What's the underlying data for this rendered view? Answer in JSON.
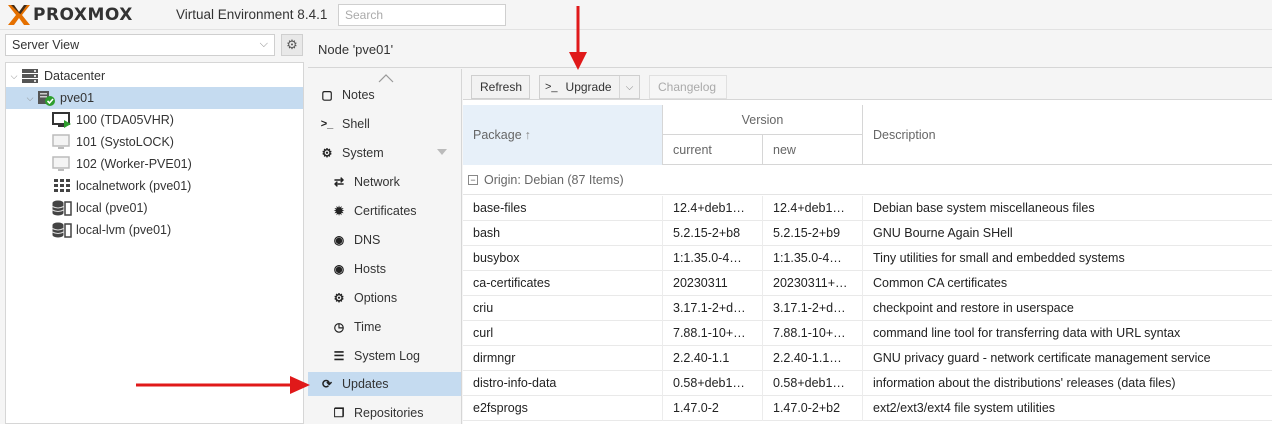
{
  "colors": {
    "accent_select": "#c5dbf0",
    "arrow": "#e0191a",
    "logo_orange": "#e57000"
  },
  "header": {
    "logo_text": "PROXMOX",
    "product": "Virtual Environment 8.4.1",
    "search_placeholder": "Search"
  },
  "left": {
    "view_select": "Server View",
    "tree": [
      {
        "label": "Datacenter",
        "icon": "datacenter-icon"
      },
      {
        "label": "pve01",
        "icon": "node-online-icon"
      },
      {
        "label": "100 (TDA05VHR)",
        "icon": "vm-running-icon"
      },
      {
        "label": "101 (SystoLOCK)",
        "icon": "vm-stopped-icon"
      },
      {
        "label": "102 (Worker-PVE01)",
        "icon": "vm-stopped-icon"
      },
      {
        "label": "localnetwork (pve01)",
        "icon": "sdn-grid-icon"
      },
      {
        "label": "local (pve01)",
        "icon": "storage-icon"
      },
      {
        "label": "local-lvm (pve01)",
        "icon": "storage-icon"
      }
    ]
  },
  "main": {
    "node_title": "Node 'pve01'",
    "menu": [
      {
        "label": "Notes",
        "icon": "notes-icon",
        "glyph": "▢"
      },
      {
        "label": "Shell",
        "icon": "shell-icon",
        "glyph": ">_"
      },
      {
        "label": "System",
        "icon": "system-cogs-icon",
        "glyph": "⚙"
      },
      {
        "label": "Network",
        "icon": "network-icon",
        "glyph": "⇄"
      },
      {
        "label": "Certificates",
        "icon": "certificate-icon",
        "glyph": "✹"
      },
      {
        "label": "DNS",
        "icon": "dns-globe-icon",
        "glyph": "◉"
      },
      {
        "label": "Hosts",
        "icon": "hosts-globe-icon",
        "glyph": "◉"
      },
      {
        "label": "Options",
        "icon": "options-gear-icon",
        "glyph": "⚙"
      },
      {
        "label": "Time",
        "icon": "clock-icon",
        "glyph": "◷"
      },
      {
        "label": "System Log",
        "icon": "log-list-icon",
        "glyph": "☰"
      },
      {
        "label": "Updates",
        "icon": "refresh-icon",
        "glyph": "⟳"
      },
      {
        "label": "Repositories",
        "icon": "repositories-icon",
        "glyph": "❐"
      }
    ],
    "toolbar": {
      "refresh": "Refresh",
      "upgrade_prefix": ">_",
      "upgrade": "Upgrade",
      "changelog": "Changelog"
    },
    "grid": {
      "headers": {
        "package": "Package",
        "version": "Version",
        "current": "current",
        "new": "new",
        "description": "Description"
      },
      "group": "Origin: Debian (87 Items)",
      "rows": [
        {
          "package": "base-files",
          "current": "12.4+deb1…",
          "new": "12.4+deb1…",
          "description": "Debian base system miscellaneous files"
        },
        {
          "package": "bash",
          "current": "5.2.15-2+b8",
          "new": "5.2.15-2+b9",
          "description": "GNU Bourne Again SHell"
        },
        {
          "package": "busybox",
          "current": "1:1.35.0-4…",
          "new": "1:1.35.0-4…",
          "description": "Tiny utilities for small and embedded systems"
        },
        {
          "package": "ca-certificates",
          "current": "20230311",
          "new": "20230311+…",
          "description": "Common CA certificates"
        },
        {
          "package": "criu",
          "current": "3.17.1-2+d…",
          "new": "3.17.1-2+d…",
          "description": "checkpoint and restore in userspace"
        },
        {
          "package": "curl",
          "current": "7.88.1-10+…",
          "new": "7.88.1-10+…",
          "description": "command line tool for transferring data with URL syntax"
        },
        {
          "package": "dirmngr",
          "current": "2.2.40-1.1",
          "new": "2.2.40-1.1…",
          "description": "GNU privacy guard - network certificate management service"
        },
        {
          "package": "distro-info-data",
          "current": "0.58+deb1…",
          "new": "0.58+deb1…",
          "description": "information about the distributions' releases (data files)"
        },
        {
          "package": "e2fsprogs",
          "current": "1.47.0-2",
          "new": "1.47.0-2+b2",
          "description": "ext2/ext3/ext4 file system utilities"
        }
      ]
    }
  }
}
